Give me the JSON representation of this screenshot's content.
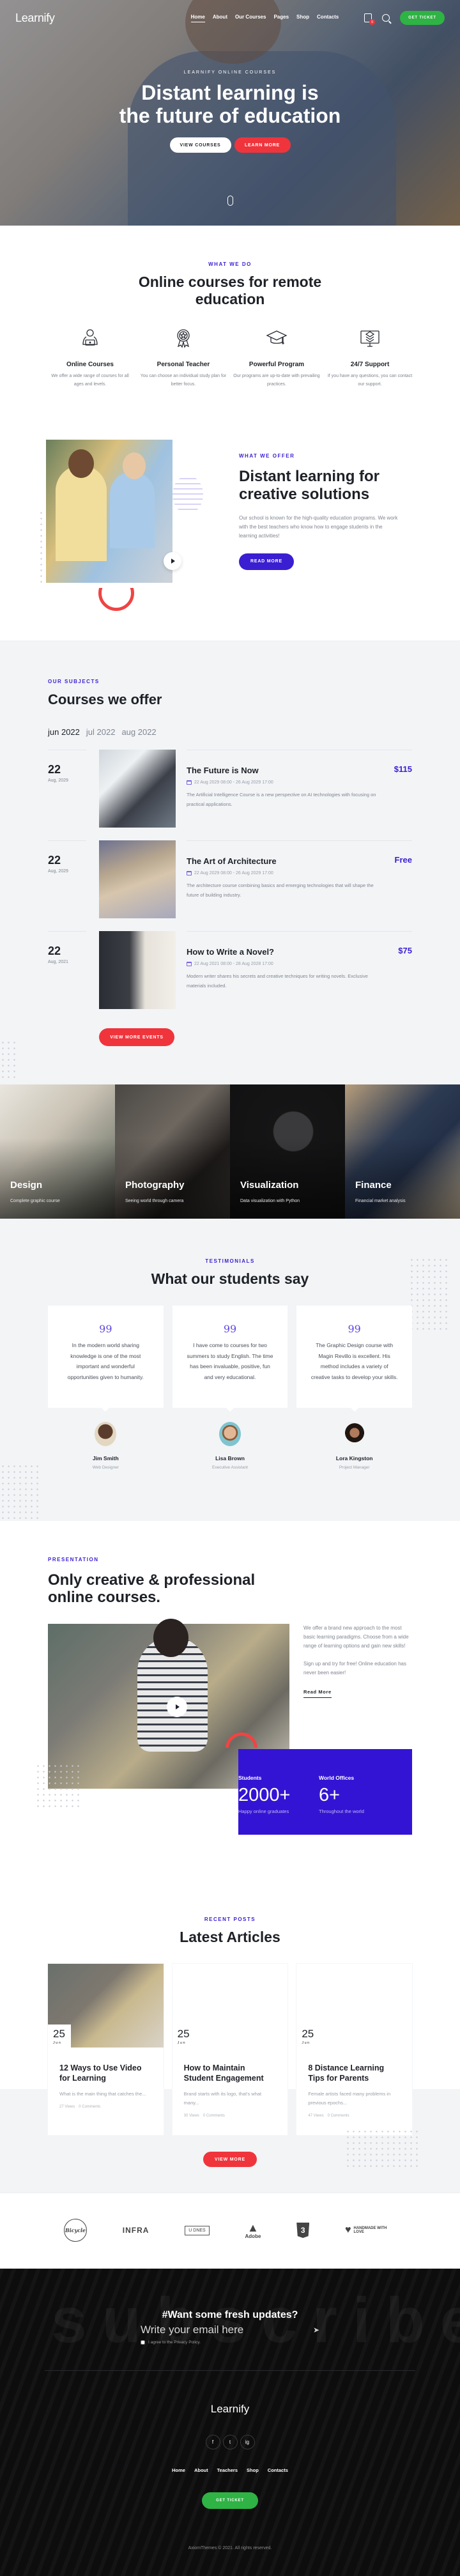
{
  "header": {
    "logo": "Learnify",
    "menu": [
      "Home",
      "About",
      "Our Courses",
      "Pages",
      "Shop",
      "Contacts"
    ],
    "active_menu": "Home",
    "cart_count": "0",
    "cta": "Get Ticket"
  },
  "hero": {
    "subtitle": "LEARNIFY ONLINE COURSES",
    "title_line1": "Distant learning is",
    "title_line2": "the future of education",
    "btn_primary": "View Courses",
    "btn_secondary": "Learn More"
  },
  "features": {
    "eyebrow": "What we do",
    "title": "Online courses for remote education",
    "items": [
      {
        "icon": "student-laptop-icon",
        "title": "Online Courses",
        "text": "We offer a wide range of courses for all ages and levels."
      },
      {
        "icon": "award-badge-icon",
        "title": "Personal Teacher",
        "text": "You can choose an individual study plan for better focus."
      },
      {
        "icon": "graduation-cap-icon",
        "title": "Powerful Program",
        "text": "Our programs are up-to-date with prevailing practices."
      },
      {
        "icon": "support-monitor-icon",
        "title": "24/7 Support",
        "text": "If you have any questions, you can contact our support."
      }
    ]
  },
  "offer": {
    "eyebrow": "What we offer",
    "title": "Distant learning for creative solutions",
    "text": "Our school is known for the high-quality education programs. We work with the best teachers who know how to engage students in the learning activities!",
    "button": "Read More"
  },
  "courses": {
    "eyebrow": "Our subjects",
    "title": "Courses we offer",
    "months": [
      "jun 2022",
      "jul 2022",
      "aug 2022"
    ],
    "active_month": "jun 2022",
    "items": [
      {
        "day": "22",
        "month": "Aug, 2029",
        "title": "The Future is Now",
        "time": "22 Aug 2029 08:00 - 26 Aug 2029 17:00",
        "desc": "The Artificial Intelligence Course is a new perspective on AI technologies with focusing on practical applications.",
        "price": "$115"
      },
      {
        "day": "22",
        "month": "Aug, 2029",
        "title": "The Art of Architecture",
        "time": "22 Aug 2029 08:00 - 26 Aug 2029 17:00",
        "desc": "The architecture course combining basics and emerging technologies that will shape the future of building industry.",
        "price": "Free"
      },
      {
        "day": "22",
        "month": "Aug, 2021",
        "title": "How to Write a Novel?",
        "time": "22 Aug 2021 08:00 - 28 Aug 2028 17:00",
        "desc": "Modern writer shares his secrets and creative techniques for writing novels. Exclusive materials included.",
        "price": "$75"
      }
    ],
    "button": "View More Events"
  },
  "categories": [
    {
      "name": "Design",
      "desc": "Complete graphic course"
    },
    {
      "name": "Photography",
      "desc": "Seeing world through camera"
    },
    {
      "name": "Visualization",
      "desc": "Data visualization with Python"
    },
    {
      "name": "Finance",
      "desc": "Financial market analysis"
    }
  ],
  "testimonials": {
    "eyebrow": "Testimonials",
    "title": "What our students say",
    "items": [
      {
        "text": "In the modern world sharing knowledge is one of the most important and wonderful opportunities given to humanity.",
        "name": "Jim Smith",
        "role": "Web Designer"
      },
      {
        "text": "I have come to courses for two summers to study English. The time has been invaluable, positive, fun and very educational.",
        "name": "Lisa Brown",
        "role": "Executive Assistant"
      },
      {
        "text": "The Graphic Design course with Magin Revillo is excellent. His method includes a variety of creative tasks to develop your skills.",
        "name": "Lora Kingston",
        "role": "Project Manager"
      }
    ]
  },
  "presentation": {
    "eyebrow": "Presentation",
    "title_line1": "Only creative & professional",
    "title_line2": "online courses.",
    "text1": "We offer a brand new approach to the most basic learning paradigms. Choose from a wide range of learning options and gain new skills!",
    "text2": "Sign up and try for free! Online education has never been easier!",
    "read_more": "Read More",
    "stats": [
      {
        "label": "Students",
        "value": "2000+",
        "desc": "Happy online graduates"
      },
      {
        "label": "World Offices",
        "value": "6+",
        "desc": "Throughout the world"
      }
    ]
  },
  "articles": {
    "eyebrow": "Recent posts",
    "title": "Latest Articles",
    "items": [
      {
        "day": "25",
        "month": "Jun",
        "title": "12 Ways to Use Video for Learning",
        "excerpt": "What is the main thing that catches the...",
        "views": "27 Views",
        "comments": "0 Comments"
      },
      {
        "day": "25",
        "month": "Jun",
        "title": "How to Maintain Student Engagement",
        "excerpt": "Brand starts with its logo, that's what many...",
        "views": "30 Views",
        "comments": "0 Comments"
      },
      {
        "day": "25",
        "month": "Jun",
        "title": "8 Distance Learning Tips for Parents",
        "excerpt": "Female artists faced many problems in previous epochs...",
        "views": "47 Views",
        "comments": "0 Comments"
      }
    ],
    "button": "View More"
  },
  "partners": [
    "Bicycle",
    "INFRA",
    "U DNES",
    "Adobe",
    "CSS3",
    "HANDMADE WITH LOVE"
  ],
  "subscribe": {
    "bg_word": "subscribe",
    "title": "#Want some fresh updates?",
    "placeholder": "Write your email here",
    "agree": "I agree to the Privacy Policy."
  },
  "footer": {
    "logo": "Learnify",
    "socials": [
      "f",
      "t",
      "ig"
    ],
    "menu": [
      "Home",
      "About",
      "Teachers",
      "Shop",
      "Contacts"
    ],
    "cta": "Get Ticket",
    "copyright": "AxiomThemes © 2021. All rights reserved."
  },
  "colors": {
    "primary": "#3a1ed1",
    "accent_red": "#f0343c",
    "green": "#2fb344",
    "dark": "#1e2127"
  }
}
